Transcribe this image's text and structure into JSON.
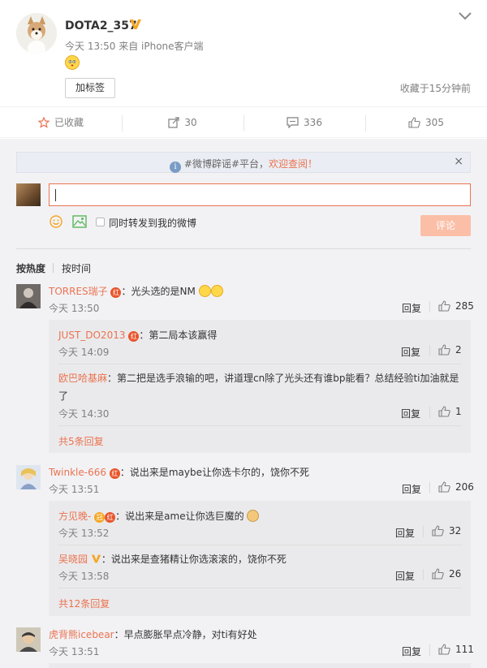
{
  "post": {
    "username": "DOTA2_357",
    "meta": "今天 13:50 来自 iPhone客户端",
    "tag_button": "加标签",
    "favorited_time": "收藏于15分钟前"
  },
  "actions": {
    "favorite": "已收藏",
    "repost": "30",
    "comment": "336",
    "like": "305"
  },
  "notice": {
    "text": "#微博辟谣#平台，",
    "link": "欢迎查阅！",
    "close": "×"
  },
  "composer": {
    "sync_label": "同时转发到我的微博",
    "submit": "评论"
  },
  "sort": {
    "hot": "按热度",
    "time": "按时间"
  },
  "colors": {
    "accent": "#eb7350",
    "submit_disabled": "#fbbfa7",
    "comment_bg": "#f2f2f5",
    "reply_bg": "#eaeaec"
  },
  "comments": [
    {
      "name": "TORRES瑞子",
      "text": "：光头选的是NM",
      "time": "今天 13:50",
      "reply": "回复",
      "likes": "285",
      "replies": [
        {
          "name": "JUST_DO2013",
          "text": "：第二局本该赢得",
          "time": "今天 14:09",
          "reply": "回复",
          "likes": "2"
        },
        {
          "name": "欧巴哈基麻",
          "text": "：第二把是选手浪输的吧，讲道理cn除了光头还有谁bp能看？总结经验ti加油就是",
          "text2": "了",
          "time": "今天 14:30",
          "reply": "回复",
          "likes": "1"
        }
      ],
      "more": "共5条回复"
    },
    {
      "name": "Twinkle-666",
      "text": "：说出来是maybe让你选卡尔的，饶你不死",
      "time": "今天 13:51",
      "reply": "回复",
      "likes": "206",
      "replies": [
        {
          "name": "方见晚-",
          "text": "：说出来是ame让你选巨魔的",
          "time": "今天 13:52",
          "reply": "回复",
          "likes": "32"
        },
        {
          "name": "吴晓园",
          "text": "：说出来是查猪精让你选滚滚的，饶你不死",
          "time": "今天 13:58",
          "reply": "回复",
          "likes": "26"
        }
      ],
      "more": "共12条回复"
    },
    {
      "name": "虎背熊icebear",
      "text": "：早点膨胀早点冷静，对ti有好处",
      "time": "今天 13:51",
      "reply": "回复",
      "likes": "111"
    }
  ]
}
